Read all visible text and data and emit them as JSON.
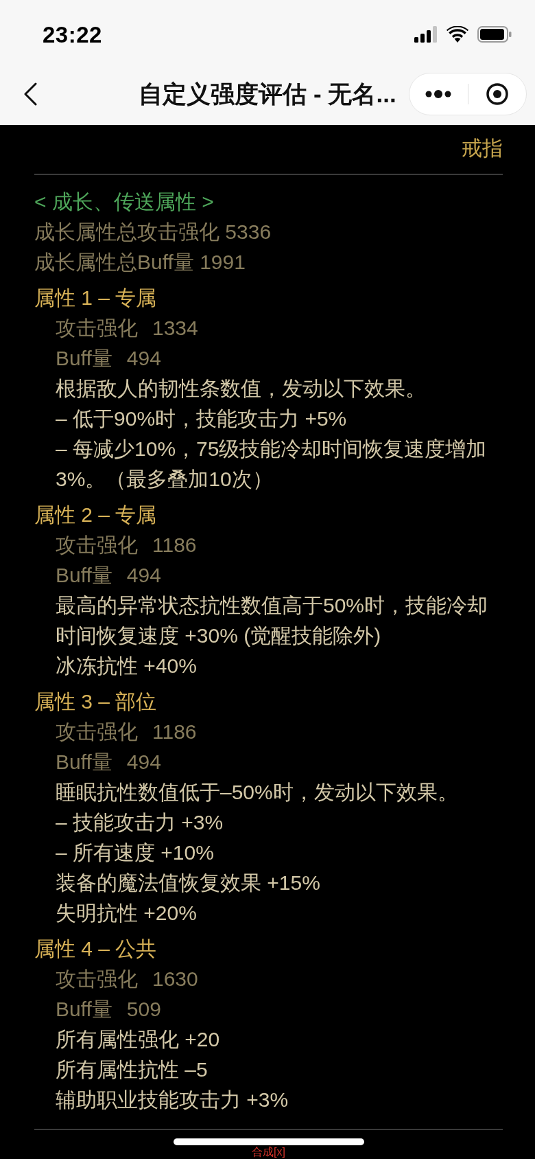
{
  "status_bar": {
    "time": "23:22"
  },
  "nav_bar": {
    "title": "自定义强度评估 - 无名..."
  },
  "item": {
    "slot": "戒指"
  },
  "growth": {
    "heading": "< 成长、传送属性 >",
    "totals": [
      "成长属性总攻击强化 5336",
      "成长属性总Buff量 1991"
    ]
  },
  "attributes": [
    {
      "title": "属性 1 – 专属",
      "stats": [
        {
          "label": "攻击强化",
          "value": "1334"
        },
        {
          "label": "Buff量",
          "value": "494"
        }
      ],
      "effects": [
        "根据敌人的韧性条数值，发动以下效果。",
        "– 低于90%时，技能攻击力 +5%",
        "– 每减少10%，75级技能冷却时间恢复速度增加3%。（最多叠加10次）"
      ]
    },
    {
      "title": "属性 2 – 专属",
      "stats": [
        {
          "label": "攻击强化",
          "value": "1186"
        },
        {
          "label": "Buff量",
          "value": "494"
        }
      ],
      "effects": [
        "最高的异常状态抗性数值高于50%时，技能冷却时间恢复速度 +30% (觉醒技能除外)",
        "冰冻抗性 +40%"
      ]
    },
    {
      "title": "属性 3 – 部位",
      "stats": [
        {
          "label": "攻击强化",
          "value": "1186"
        },
        {
          "label": "Buff量",
          "value": "494"
        }
      ],
      "effects": [
        "睡眠抗性数值低于–50%时，发动以下效果。",
        "– 技能攻击力 +3%",
        "– 所有速度 +10%",
        "装备的魔法值恢复效果 +15%",
        "失明抗性 +20%"
      ]
    },
    {
      "title": "属性 4 – 公共",
      "stats": [
        {
          "label": "攻击强化",
          "value": "1630"
        },
        {
          "label": "Buff量",
          "value": "509"
        }
      ],
      "effects": [
        "所有属性强化 +20",
        "所有属性抗性 –5",
        "辅助职业技能攻击力 +3%"
      ]
    }
  ],
  "footer": {
    "action": "合成[x]"
  }
}
